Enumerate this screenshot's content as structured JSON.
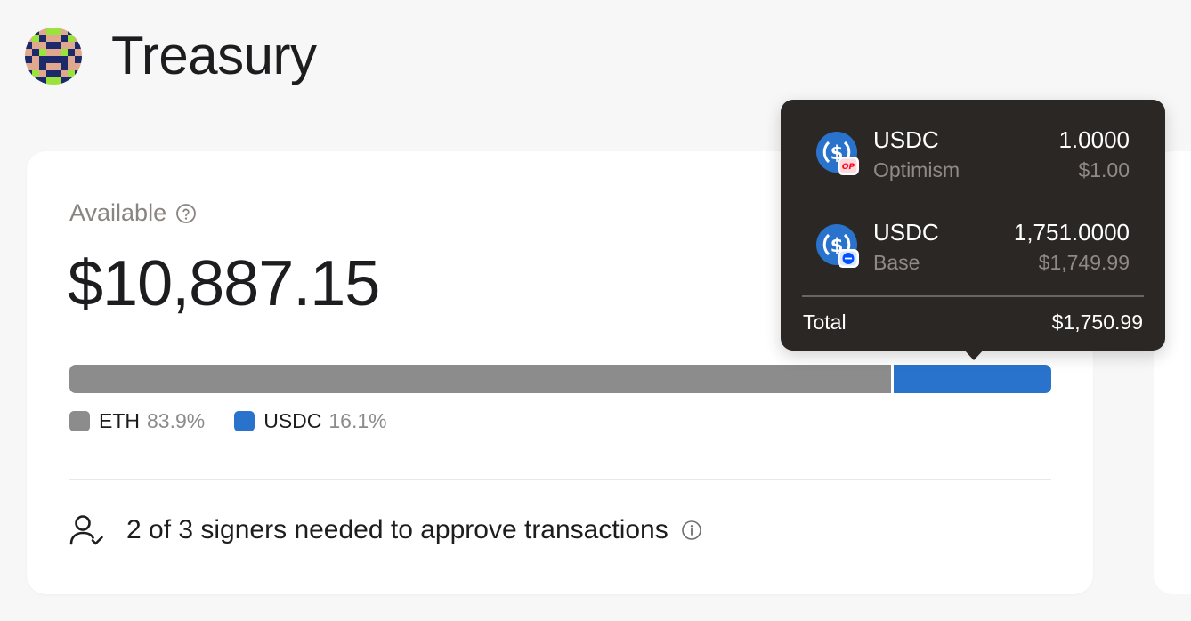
{
  "header": {
    "title": "Treasury",
    "avatar_icon": "pixel-avatar-icon"
  },
  "summary": {
    "available_label": "Available",
    "balance": "$10,887.15"
  },
  "allocation": {
    "assets": [
      {
        "name": "ETH",
        "percent_label": "83.9%",
        "fraction": 0.839,
        "color": "#8c8c8c"
      },
      {
        "name": "USDC",
        "percent_label": "16.1%",
        "fraction": 0.161,
        "color": "#2a73cc"
      }
    ]
  },
  "signers": {
    "text": "2 of 3 signers needed to approve transactions"
  },
  "tooltip": {
    "tokens": [
      {
        "name": "USDC",
        "chain": "Optimism",
        "amount": "1.0000",
        "value": "$1.00",
        "chain_badge": "OP",
        "chain_color": "#ff0420"
      },
      {
        "name": "USDC",
        "chain": "Base",
        "amount": "1,751.0000",
        "value": "$1,749.99",
        "chain_badge": "",
        "chain_color": "#0052ff"
      }
    ],
    "total_label": "Total",
    "total_value": "$1,750.99"
  },
  "colors": {
    "usdc_blue": "#2a73cc",
    "eth_gray": "#8c8c8c",
    "tooltip_bg": "#2b2725"
  }
}
